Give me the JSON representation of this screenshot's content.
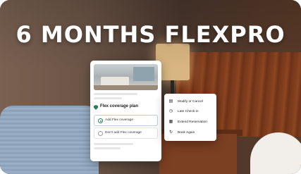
{
  "headline": "6 MONTHS FLEXPRO",
  "card": {
    "plan_title": "Flex coverage plan",
    "options": [
      {
        "label": "Add Flex coverage",
        "selected": true
      },
      {
        "label": "Don't add Flex coverage",
        "selected": false
      }
    ]
  },
  "menu": {
    "items": [
      {
        "label": "Modify or Cancel",
        "icon": "calendar-icon"
      },
      {
        "label": "Late Check-in",
        "icon": "clock-icon"
      },
      {
        "label": "Extend Reservation",
        "icon": "calendar-plus-icon"
      },
      {
        "label": "Book Again",
        "icon": "refresh-icon"
      }
    ]
  },
  "colors": {
    "accent_green": "#2f7d5b",
    "selected_border": "#b9cfe6",
    "wood": "#7a3b1c"
  }
}
